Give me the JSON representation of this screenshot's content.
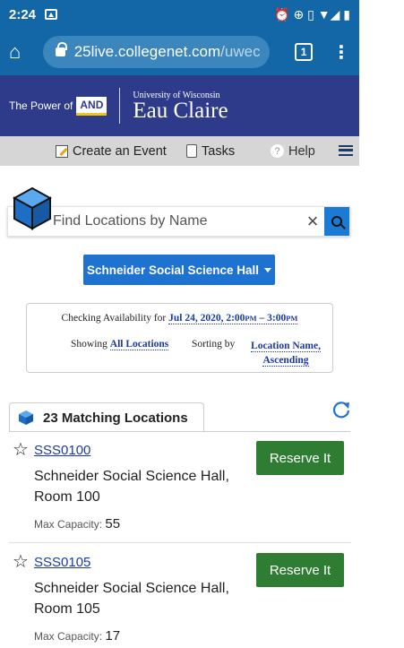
{
  "status_bar": {
    "time": "2:24",
    "right_icons": "⏰ ⊕ ▯ ▼◢ ▮"
  },
  "browser": {
    "url_main": "25live.collegenet.com",
    "url_tail": "/uwec",
    "tab_count": "1"
  },
  "banner": {
    "power_text": "The Power of",
    "and_badge": "AND",
    "uw_small": "University of Wisconsin",
    "uw_big": "Eau Claire"
  },
  "nav": {
    "create_event": "Create an Event",
    "tasks": "Tasks",
    "help": "Help",
    "help_glyph": "?"
  },
  "search": {
    "placeholder": "Find Locations by Name",
    "clear": "×"
  },
  "building": {
    "label": "Schneider Social Science Hall"
  },
  "availability": {
    "checking_label": "Checking Availability for",
    "date_part": "Jul 24, 2020, 2:00",
    "pm1": "PM",
    "dash": " – 3:00",
    "pm2": "PM",
    "showing_label": "Showing",
    "showing_value": "All Locations",
    "sorting_label": "Sorting by",
    "sorting_value_1": "Location Name,",
    "sorting_value_2": "Ascending"
  },
  "results": {
    "count_label": "23 Matching Locations",
    "items": [
      {
        "code": "SSS0100",
        "name": "Schneider Social Science Hall, Room 100",
        "capacity_label": "Max Capacity:",
        "capacity": "55",
        "action": "Reserve It"
      },
      {
        "code": "SSS0105",
        "name": "Schneider Social Science Hall, Room 105",
        "capacity_label": "Max Capacity:",
        "capacity": "17",
        "action": "Reserve It"
      }
    ]
  },
  "colors": {
    "chrome_blue": "#1467a6",
    "banner_navy": "#2d3b8a",
    "primary_blue": "#1e73d0",
    "reserve_green": "#2e7d32"
  }
}
